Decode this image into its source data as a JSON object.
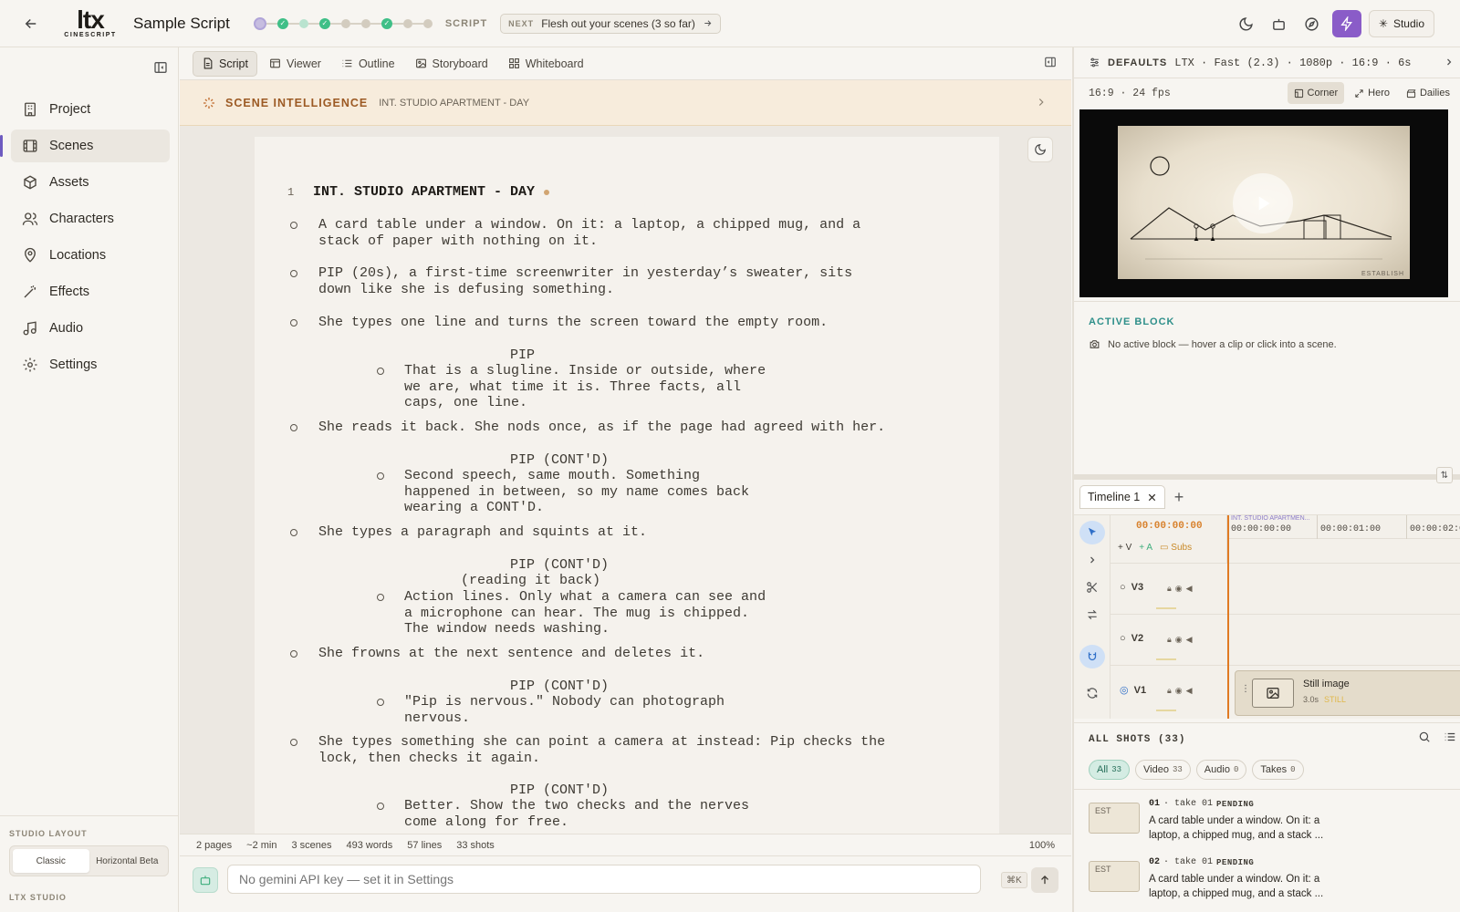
{
  "topbar": {
    "title": "Sample Script",
    "script_label": "SCRIPT",
    "next_tag": "NEXT",
    "next_text": "Flesh out your scenes (3 so far)",
    "studio_label": "Studio",
    "logo_main": "ltx",
    "logo_sub": "CINESCRIPT"
  },
  "sidebar": {
    "items": [
      {
        "label": "Project",
        "icon": "building-icon"
      },
      {
        "label": "Scenes",
        "icon": "film-icon",
        "active": true
      },
      {
        "label": "Assets",
        "icon": "cube-icon"
      },
      {
        "label": "Characters",
        "icon": "users-icon"
      },
      {
        "label": "Locations",
        "icon": "map-pin-icon"
      },
      {
        "label": "Effects",
        "icon": "wand-icon"
      },
      {
        "label": "Audio",
        "icon": "music-icon"
      },
      {
        "label": "Settings",
        "icon": "gear-icon"
      }
    ],
    "layout_label": "STUDIO LAYOUT",
    "layout_classic": "Classic",
    "layout_horizontal": "Horizontal Beta",
    "footer": "LTX STUDIO"
  },
  "tabs": [
    "Script",
    "Viewer",
    "Outline",
    "Storyboard",
    "Whiteboard"
  ],
  "scene_intel": {
    "label": "SCENE INTELLIGENCE",
    "scene": "INT. STUDIO APARTMENT - DAY"
  },
  "script": {
    "scene_number": "1",
    "slugline": "INT. STUDIO APARTMENT - DAY",
    "action1": "A card table under a window. On it: a laptop, a chipped mug, and a\nstack of paper with nothing on it.",
    "action2": "PIP (20s), a first-time screenwriter in yesterday’s sweater, sits\ndown like she is defusing something.",
    "action3": "She types one line and turns the screen toward the empty room.",
    "char1": "PIP",
    "dial1": "That is a slugline. Inside or outside, where\nwe are, what time it is. Three facts, all\ncaps, one line.",
    "action4": "She reads it back. She nods once, as if the page had agreed with her.",
    "char2": "PIP (CONT'D)",
    "dial2": "Second speech, same mouth. Something\nhappened in between, so my name comes back\nwearing a CONT'D.",
    "action5": "She types a paragraph and squints at it.",
    "char3": "PIP (CONT'D)",
    "paren3": "(reading it back)",
    "dial3": "Action lines. Only what a camera can see and\na microphone can hear. The mug is chipped.\nThe window needs washing.",
    "action6": "She frowns at the next sentence and deletes it.",
    "char4": "PIP (CONT'D)",
    "dial4": "\"Pip is nervous.\" Nobody can photograph\nnervous.",
    "action7": "She types something she can point a camera at instead: Pip checks the\nlock, then checks it again.",
    "char5": "PIP (CONT'D)",
    "dial5": "Better. Show the two checks and the nerves\ncome along for free."
  },
  "status": {
    "pages": "2 pages",
    "duration": "~2 min",
    "scenes": "3 scenes",
    "words": "493 words",
    "lines": "57 lines",
    "shots": "33 shots",
    "zoom": "100%"
  },
  "prompt": {
    "placeholder": "No gemini API key — set it in Settings",
    "shortcut": "⌘K"
  },
  "defaults": {
    "label": "DEFAULTS",
    "value": "LTX · Fast (2.3) · 1080p · 16:9 · 6s · 24fps"
  },
  "preview": {
    "aspect": "16:9 · 24 fps",
    "opt_corner": "Corner",
    "opt_hero": "Hero",
    "opt_dailies": "Dailies",
    "frame_tag": "ESTABLISH"
  },
  "active_block": {
    "title": "ACTIVE BLOCK",
    "text": "No active block — hover a clip or click into a scene."
  },
  "timeline": {
    "tab": "Timeline 1",
    "timecode": "00:00:00:00",
    "add_v": "+ V",
    "add_a": "+ A",
    "subs": "Subs",
    "ruler_scene": "INT. STUDIO APARTMEN...",
    "ruler_marks": [
      "00:00:00:00",
      "00:00:01:00",
      "00:00:02:00"
    ],
    "tracks": [
      "V3",
      "V2",
      "V1"
    ],
    "clip_title": "Still image",
    "clip_duration": "3.0s",
    "clip_still": "STILL"
  },
  "shots": {
    "title": "ALL SHOTS (33)",
    "filters": [
      {
        "label": "All",
        "count": "33",
        "active": true
      },
      {
        "label": "Video",
        "count": "33"
      },
      {
        "label": "Audio",
        "count": "0"
      },
      {
        "label": "Takes",
        "count": "0"
      }
    ],
    "items": [
      {
        "num": "01",
        "take": "· take 01",
        "status": "PENDING",
        "thumb": "EST",
        "desc": "A card table under a window. On it: a laptop, a chipped mug, and a stack ..."
      },
      {
        "num": "02",
        "take": "· take 01",
        "status": "PENDING",
        "thumb": "EST",
        "desc": "A card table under a window. On it: a laptop, a chipped mug, and a stack ..."
      }
    ]
  },
  "colors": {
    "accent": "#8a5cc8",
    "playhead": "#e07a22",
    "scene_intel": "#9c5a24",
    "active_block": "#2e8f8a"
  }
}
